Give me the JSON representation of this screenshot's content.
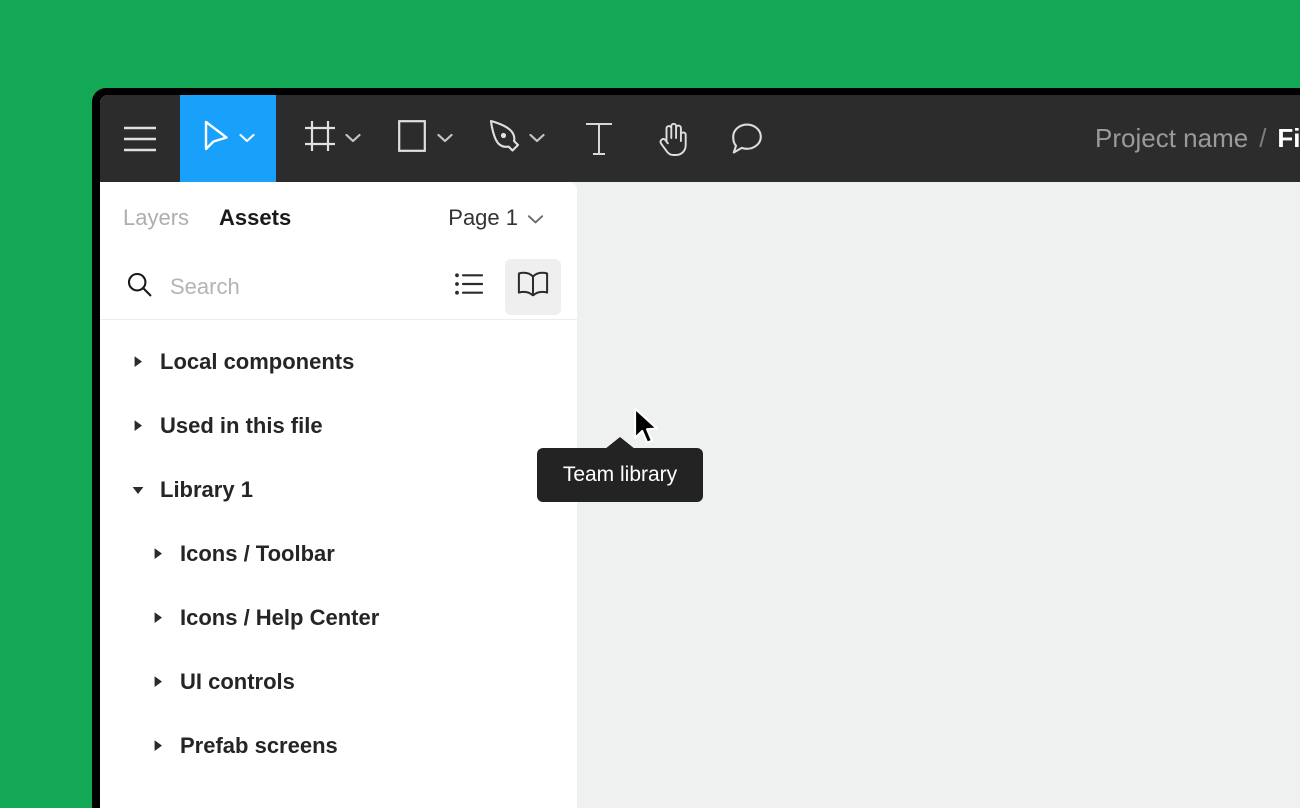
{
  "theme": {
    "desktop_background": "#12a855",
    "toolbar_background": "#2c2c2c",
    "accent_blue": "#18a0fb",
    "canvas_background": "#eff0f0",
    "panel_background": "#ffffff",
    "tooltip_background": "#232323"
  },
  "toolbar": {
    "menu_icon": "hamburger-menu-icon",
    "tools": [
      {
        "name": "move-tool",
        "icon": "cursor-arrow-icon",
        "has_dropdown": true,
        "active": true
      },
      {
        "name": "frame-tool",
        "icon": "frame-icon",
        "has_dropdown": true,
        "active": false
      },
      {
        "name": "shape-tool",
        "icon": "rectangle-icon",
        "has_dropdown": true,
        "active": false
      },
      {
        "name": "pen-tool",
        "icon": "pen-icon",
        "has_dropdown": true,
        "active": false
      },
      {
        "name": "text-tool",
        "icon": "text-icon",
        "has_dropdown": false,
        "active": false
      },
      {
        "name": "hand-tool",
        "icon": "hand-icon",
        "has_dropdown": false,
        "active": false
      },
      {
        "name": "comment-tool",
        "icon": "comment-icon",
        "has_dropdown": false,
        "active": false
      }
    ],
    "breadcrumb": {
      "project": "Project name",
      "separator": "/",
      "file": "File nam"
    }
  },
  "panel": {
    "tabs": {
      "layers": "Layers",
      "assets": "Assets",
      "active": "Assets"
    },
    "page_selector": {
      "label": "Page 1",
      "chevron": "chevron-down-icon"
    },
    "search": {
      "placeholder": "Search",
      "value": "",
      "icon": "search-icon"
    },
    "view_toggles": [
      {
        "name": "list-view",
        "icon": "list-icon",
        "active": false
      },
      {
        "name": "team-library",
        "icon": "book-icon",
        "active": true
      }
    ],
    "tree": [
      {
        "label": "Local components",
        "level": 0,
        "expanded": false
      },
      {
        "label": "Used in this file",
        "level": 0,
        "expanded": false
      },
      {
        "label": "Library 1",
        "level": 0,
        "expanded": true
      },
      {
        "label": "Icons / Toolbar",
        "level": 1,
        "expanded": false
      },
      {
        "label": "Icons / Help Center",
        "level": 1,
        "expanded": false
      },
      {
        "label": "UI controls",
        "level": 1,
        "expanded": false
      },
      {
        "label": "Prefab screens",
        "level": 1,
        "expanded": false
      }
    ]
  },
  "tooltip": {
    "label": "Team library"
  }
}
